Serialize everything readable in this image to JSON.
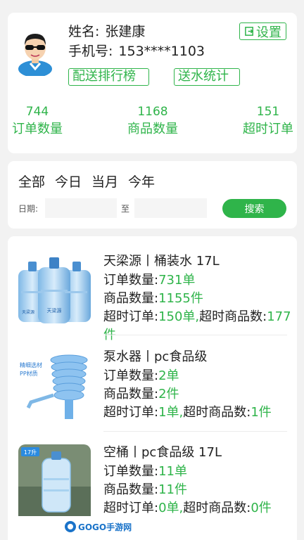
{
  "profile": {
    "name_label": "姓名:",
    "name_value": "张建康",
    "phone_label": "手机号:",
    "phone_value": "153****1103",
    "settings_label": "设置",
    "rank_label": "配送排行榜",
    "stat_label": "送水统计",
    "stats": [
      {
        "value": "744",
        "label": "订单数量"
      },
      {
        "value": "1168",
        "label": "商品数量"
      },
      {
        "value": "151",
        "label": "超时订单"
      }
    ]
  },
  "filter": {
    "tabs": [
      "全部",
      "今日",
      "当月",
      "今年"
    ],
    "date_label": "日期:",
    "date_separator": "至",
    "search_label": "搜索"
  },
  "products": [
    {
      "title": "天梁源丨桶装水 17L",
      "orders_label": "订单数量:",
      "orders_value": "731单",
      "goods_label": "商品数量:",
      "goods_value": "1155件",
      "overtime_label": "超时订单:",
      "overtime_value": "150单,",
      "overtime_goods_label": "超时商品数:",
      "overtime_goods_value": "177件",
      "image_text": "天梁源"
    },
    {
      "title": "泵水器丨pc食品级",
      "orders_label": "订单数量:",
      "orders_value": "2单",
      "goods_label": "商品数量:",
      "goods_value": "2件",
      "overtime_label": "超时订单:",
      "overtime_value": "1单,",
      "overtime_goods_label": "超时商品数:",
      "overtime_goods_value": "1件",
      "image_text_1": "精细选材",
      "image_text_2": "PP材质"
    },
    {
      "title": "空桶丨pc食品级 17L",
      "orders_label": "订单数量:",
      "orders_value": "11单",
      "goods_label": "商品数量:",
      "goods_value": "11件",
      "overtime_label": "超时订单:",
      "overtime_value": "0单,",
      "overtime_goods_label": "超时商品数:",
      "overtime_goods_value": "0件",
      "image_badge": "17升"
    }
  ],
  "watermark": {
    "text": "GOGO手游网"
  },
  "colors": {
    "accent": "#2fb44a",
    "background": "#f2f2f2"
  }
}
